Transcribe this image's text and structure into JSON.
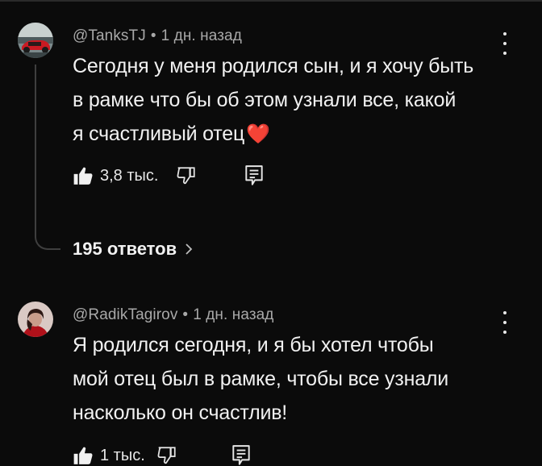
{
  "comments": [
    {
      "author": "@TanksTJ",
      "separator": "•",
      "time": "1 дн. назад",
      "text_lines": [
        "Сегодня у меня родился сын, и я хочу быть",
        "в рамке что бы об этом узнали все, какой",
        "я счастливый отец"
      ],
      "emoji": "❤️",
      "likes": "3,8 тыс.",
      "replies_label": "195 ответов",
      "icons": [
        "like-icon",
        "dislike-icon",
        "reply-icon",
        "more-icon",
        "chevron-right-icon"
      ]
    },
    {
      "author": "@RadikTagirov",
      "separator": "•",
      "time": "1 дн. назад",
      "text_lines": [
        "Я родился сегодня, и я бы хотел чтобы",
        "мой отец был в рамке, чтобы все узнали",
        "насколько он счастлив!"
      ],
      "likes": "1 тыс.",
      "icons": [
        "like-icon",
        "dislike-icon",
        "reply-icon",
        "more-icon"
      ]
    }
  ],
  "colors": {
    "background": "#0b0b0b",
    "text": "#f1f1f1",
    "meta": "#a8a8a8",
    "heart": "#e1282d",
    "thread_line": "#3f3f3f"
  }
}
